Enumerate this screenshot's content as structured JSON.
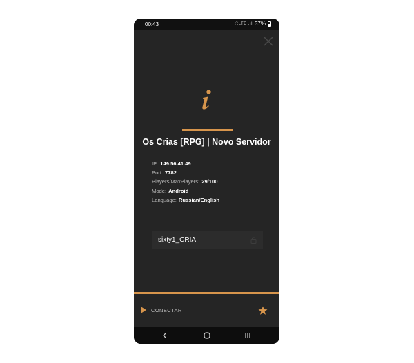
{
  "status_bar": {
    "time": "00:43",
    "icons_text": "҉ LTE .ıl",
    "battery_percent": "37%"
  },
  "server": {
    "title": "Os Crias [RPG] | Novo Servidor",
    "details": [
      {
        "label": "IP:",
        "value": "149.56.41.49"
      },
      {
        "label": "Port:",
        "value": "7782"
      },
      {
        "label": "Players/MaxPlayers:",
        "value": "29/100"
      },
      {
        "label": "Mode:",
        "value": "Android"
      },
      {
        "label": "Language:",
        "value": "Russian/English"
      }
    ]
  },
  "nickname_field": {
    "value": "sixty1_CRIA"
  },
  "actions": {
    "connect_label": "CONECTAR"
  },
  "colors": {
    "accent": "#d7954c",
    "background": "#252525"
  },
  "icons": [
    "close-icon",
    "info-icon",
    "lock-icon",
    "play-icon",
    "star-icon",
    "nav-back-icon",
    "nav-home-icon",
    "nav-recents-icon"
  ]
}
